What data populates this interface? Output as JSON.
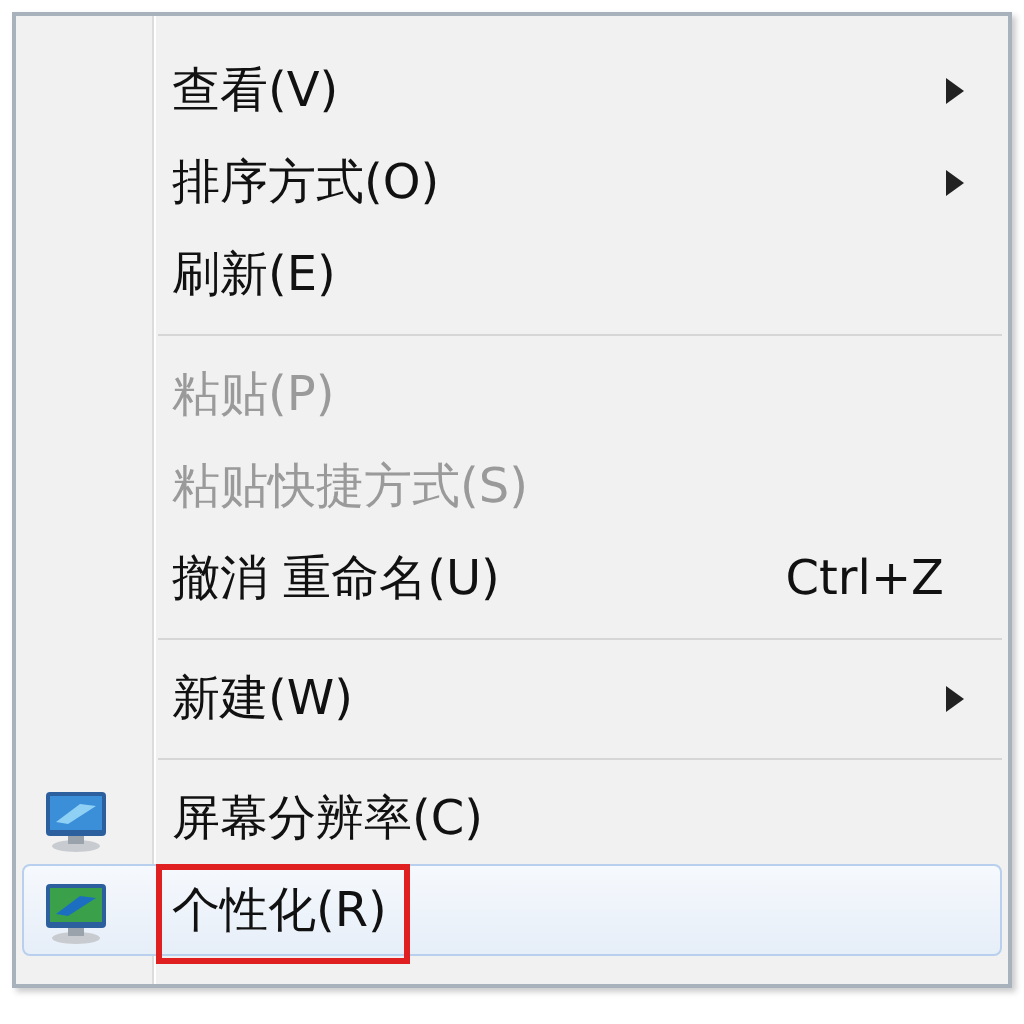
{
  "menu": {
    "items": [
      {
        "kind": "item",
        "label": "查看(V)",
        "submenu": true,
        "disabled": false,
        "selected": false,
        "icon": false,
        "outlined": false
      },
      {
        "kind": "item",
        "label": "排序方式(O)",
        "submenu": true,
        "disabled": false,
        "selected": false,
        "icon": false,
        "outlined": false
      },
      {
        "kind": "item",
        "label": "刷新(E)",
        "submenu": false,
        "disabled": false,
        "selected": false,
        "icon": false,
        "outlined": false
      },
      {
        "kind": "separator"
      },
      {
        "kind": "item",
        "label": "粘贴(P)",
        "submenu": false,
        "disabled": true,
        "selected": false,
        "icon": false,
        "outlined": false
      },
      {
        "kind": "item",
        "label": "粘贴快捷方式(S)",
        "submenu": false,
        "disabled": true,
        "selected": false,
        "icon": false,
        "outlined": false
      },
      {
        "kind": "item",
        "label": "撤消 重命名(U)",
        "shortcut": "Ctrl+Z",
        "submenu": false,
        "disabled": false,
        "selected": false,
        "icon": false,
        "outlined": false
      },
      {
        "kind": "separator"
      },
      {
        "kind": "item",
        "label": "新建(W)",
        "submenu": true,
        "disabled": false,
        "selected": false,
        "icon": false,
        "outlined": false
      },
      {
        "kind": "separator"
      },
      {
        "kind": "item",
        "label": "屏幕分辨率(C)",
        "submenu": false,
        "disabled": false,
        "selected": false,
        "icon": true,
        "outlined": false
      },
      {
        "kind": "item",
        "label": "个性化(R)",
        "submenu": false,
        "disabled": false,
        "selected": true,
        "icon": true,
        "outlined": true
      }
    ]
  }
}
